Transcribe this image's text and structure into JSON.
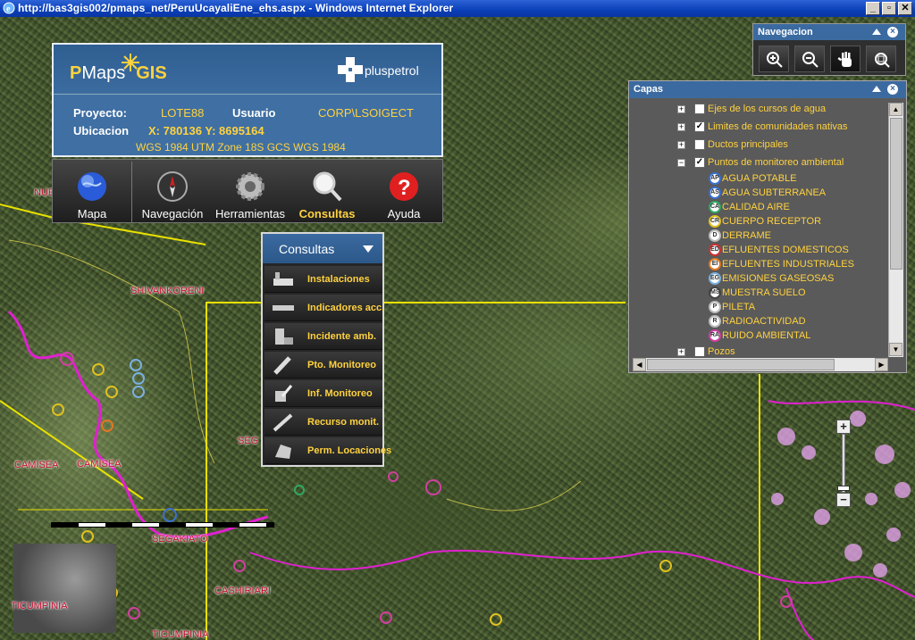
{
  "window": {
    "title": "http://bas3gis002/pmaps_net/PeruUcayaliEne_ehs.aspx - Windows Internet Explorer"
  },
  "header": {
    "logo_left_a": "P",
    "logo_left_b": "Maps",
    "logo_left_c": "GIS",
    "logo_right": "pluspetrol",
    "proyecto_label": "Proyecto:",
    "proyecto_value": "LOTE88",
    "usuario_label": "Usuario",
    "usuario_value": "CORP\\LSOIGECT",
    "ubicacion_label": "Ubicacion",
    "coords": "X: 780136 Y: 8695164",
    "datum": "WGS 1984 UTM Zone 18S GCS WGS 1984"
  },
  "toolbar": {
    "items": [
      {
        "label": "Mapa"
      },
      {
        "label": "Navegación"
      },
      {
        "label": "Herramientas"
      },
      {
        "label": "Consultas"
      },
      {
        "label": "Ayuda"
      }
    ]
  },
  "consultas": {
    "title": "Consultas",
    "items": [
      {
        "label": "Instalaciones"
      },
      {
        "label": "Indicadores acc."
      },
      {
        "label": "Incidente amb."
      },
      {
        "label": "Pto. Monitoreo"
      },
      {
        "label": "Inf. Monitoreo"
      },
      {
        "label": "Recurso monit."
      },
      {
        "label": "Perm. Locaciones"
      }
    ]
  },
  "navegacion": {
    "title": "Navegacion",
    "tools": [
      "zoom-in-icon",
      "zoom-out-icon",
      "pan-hand-icon",
      "zoom-extent-icon"
    ]
  },
  "capas": {
    "title": "Capas",
    "layers": [
      {
        "label": "Ejes de los cursos de agua",
        "checked": false
      },
      {
        "label": "Limites de comunidades nativas",
        "checked": true
      },
      {
        "label": "Ductos principales",
        "checked": false
      },
      {
        "label": "Puntos de monitoreo ambiental",
        "checked": true
      },
      {
        "label": "Pozos",
        "checked": false
      }
    ],
    "legend": [
      {
        "code": "AP",
        "label": "AGUA POTABLE",
        "color": "#3a6fd0"
      },
      {
        "code": "AS",
        "label": "AGUA SUBTERRANEA",
        "color": "#3a6fd0"
      },
      {
        "code": "CA",
        "label": "CALIDAD AIRE",
        "color": "#2fa860"
      },
      {
        "code": "CR",
        "label": "CUERPO RECEPTOR",
        "color": "#e0c020"
      },
      {
        "code": "D",
        "label": "DERRAME",
        "color": "#bbbbbb"
      },
      {
        "code": "ED",
        "label": "EFLUENTES DOMESTICOS",
        "color": "#d03030"
      },
      {
        "code": "EI",
        "label": "EFLUENTES INDUSTRIALES",
        "color": "#e07820"
      },
      {
        "code": "EG",
        "label": "EMISIONES GASEOSAS",
        "color": "#7ab0e0"
      },
      {
        "code": "MS",
        "label": "MUESTRA SUELO",
        "color": "#444444"
      },
      {
        "code": "P",
        "label": "PILETA",
        "color": "#bbbbbb"
      },
      {
        "code": "R",
        "label": "RADIOACTIVIDAD",
        "color": "#bbbbbb"
      },
      {
        "code": "RA",
        "label": "RUIDO AMBIENTAL",
        "color": "#d040a0"
      }
    ]
  },
  "map": {
    "labels": [
      "NUEVA",
      "SHIVANKORENI",
      "CAMISEA",
      "CAMISEA",
      "SEG",
      "SEGAKIATO",
      "CASHIRIARI",
      "TICUMPINIA",
      "TICUMPINIA"
    ]
  }
}
